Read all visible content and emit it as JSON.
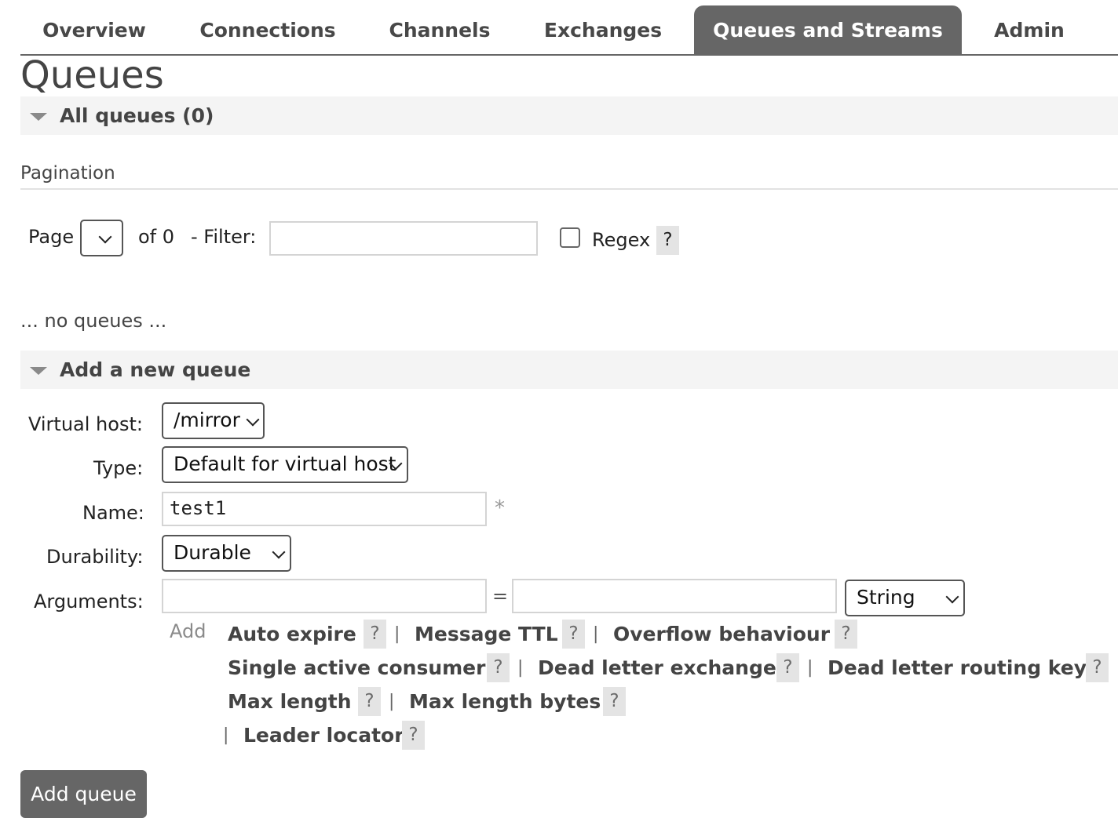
{
  "nav": {
    "tabs": [
      {
        "label": "Overview"
      },
      {
        "label": "Connections"
      },
      {
        "label": "Channels"
      },
      {
        "label": "Exchanges"
      },
      {
        "label": "Queues and Streams",
        "active": true
      },
      {
        "label": "Admin"
      }
    ]
  },
  "page": {
    "title": "Queues"
  },
  "all_queues": {
    "heading": "All queues (0)"
  },
  "pagination": {
    "label": "Pagination",
    "page_label": "Page",
    "page_value": "",
    "of_text": "of 0",
    "filter_label": "- Filter:",
    "filter_value": "",
    "regex_label": "Regex",
    "regex_checked": false,
    "help": "?"
  },
  "empty_message": "... no queues ...",
  "add_queue": {
    "heading": "Add a new queue",
    "virtual_host": {
      "label": "Virtual host:",
      "value": "/mirror"
    },
    "type": {
      "label": "Type:",
      "value": "Default for virtual host"
    },
    "name": {
      "label": "Name:",
      "value": "test1",
      "required_mark": "*"
    },
    "durability": {
      "label": "Durability:",
      "value": "Durable"
    },
    "arguments": {
      "label": "Arguments:",
      "key_value": "",
      "equals": "=",
      "value_value": "",
      "type_value": "String",
      "add_label": "Add",
      "help": "?",
      "separator": "|",
      "links": [
        "Auto expire",
        "Message TTL",
        "Overflow behaviour",
        "Single active consumer",
        "Dead letter exchange",
        "Dead letter routing key",
        "Max length",
        "Max length bytes",
        "Leader locator"
      ]
    },
    "submit_label": "Add queue"
  },
  "colors": {
    "tab_active_bg": "#666666",
    "section_bg": "#f4f4f4",
    "help_bg": "#e4e4e4",
    "button_bg": "#666666"
  }
}
